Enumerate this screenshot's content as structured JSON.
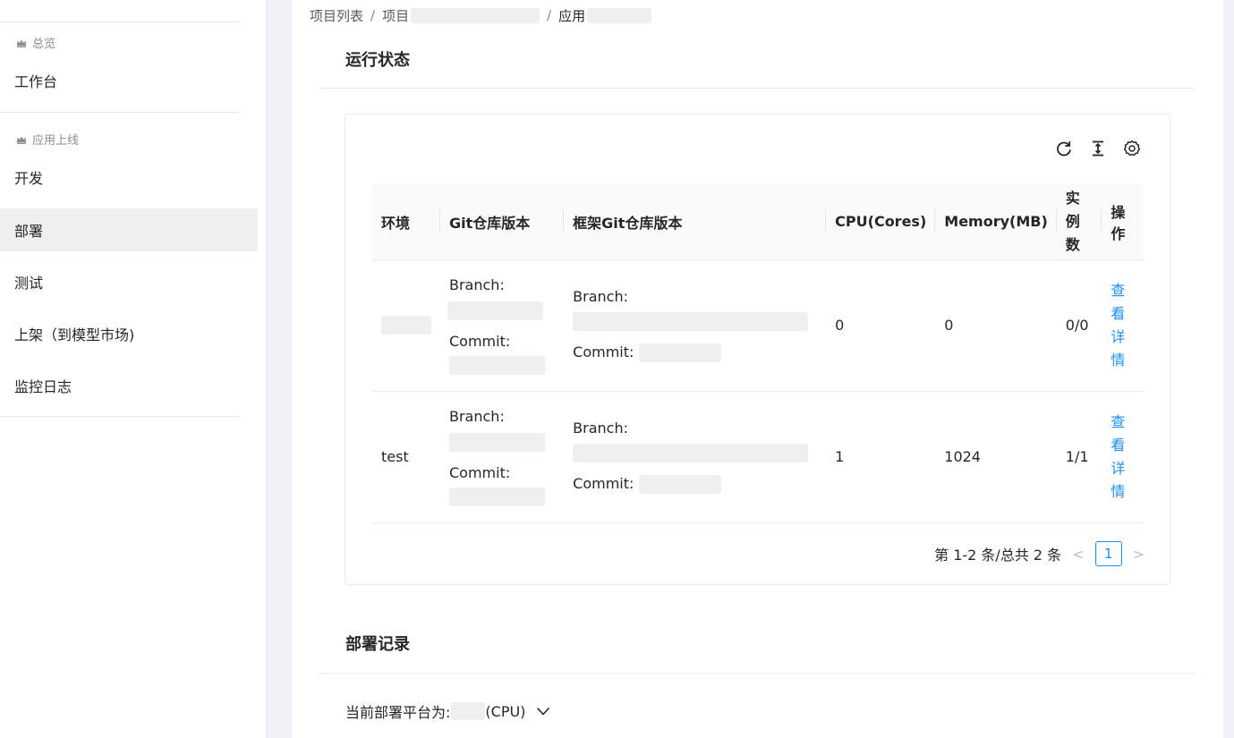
{
  "sidebar": {
    "groups": [
      {
        "label": "总览"
      },
      {
        "label": "应用上线"
      }
    ],
    "items": [
      {
        "label": "工作台"
      },
      {
        "label": "开发"
      },
      {
        "label": "部署"
      },
      {
        "label": "测试"
      },
      {
        "label": "上架（到模型市场)"
      },
      {
        "label": "监控日志"
      }
    ]
  },
  "breadcrumb": {
    "items": [
      "项目列表",
      "项目",
      "应用"
    ],
    "separator": "/"
  },
  "running_status": {
    "title": "运行状态",
    "toolbar": [
      "reload-icon",
      "column-height-icon",
      "setting-icon"
    ],
    "columns": [
      "环境",
      "Git仓库版本",
      "框架Git仓库版本",
      "CPU(Cores)",
      "Memory(MB)",
      "实例数",
      "操作"
    ],
    "rows": [
      {
        "env": "",
        "branch_label": "Branch:",
        "commit_label": "Commit:",
        "fw_branch_label": "Branch:",
        "fw_commit_label": "Commit:",
        "cpu": "0",
        "memory": "0",
        "instances": "0/0",
        "action": "查看详情"
      },
      {
        "env": "test",
        "branch_label": "Branch:",
        "commit_label": "Commit:",
        "fw_branch_label": "Branch:",
        "fw_commit_label": "Commit:",
        "cpu": "1",
        "memory": "1024",
        "instances": "1/1",
        "action": "查看详情"
      }
    ],
    "pagination": {
      "summary": "第 1-2 条/总共 2 条",
      "current_page": "1",
      "prev": "<",
      "next": ">"
    }
  },
  "deploy_records": {
    "title": "部署记录",
    "platform_label": "当前部署平台为:",
    "platform_value": "(CPU)"
  },
  "colors": {
    "accent": "#1890ff",
    "redaction": "#efefef",
    "active_bg": "#f0f0f0"
  }
}
